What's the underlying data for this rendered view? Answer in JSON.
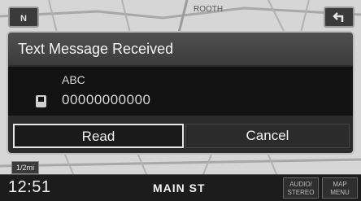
{
  "dialog": {
    "title": "Text Message Received",
    "sender": "ABC",
    "phone_number": "00000000000",
    "read_label": "Read",
    "cancel_label": "Cancel",
    "phone_icon": "phone-icon"
  },
  "map": {
    "north_label": "N",
    "scale_label": "1/2mi",
    "road_label": "ROOTH"
  },
  "status_bar": {
    "time": "12:51",
    "street": "MAIN ST",
    "audio_label": "AUDIO/\nSTEREO",
    "map_menu_label": "MAP\nMENU"
  },
  "colors": {
    "dialog_bg": "#2b2b2b",
    "title_bg": "#464646",
    "body_bg": "#121212",
    "map_bg": "#d9d9d9"
  }
}
